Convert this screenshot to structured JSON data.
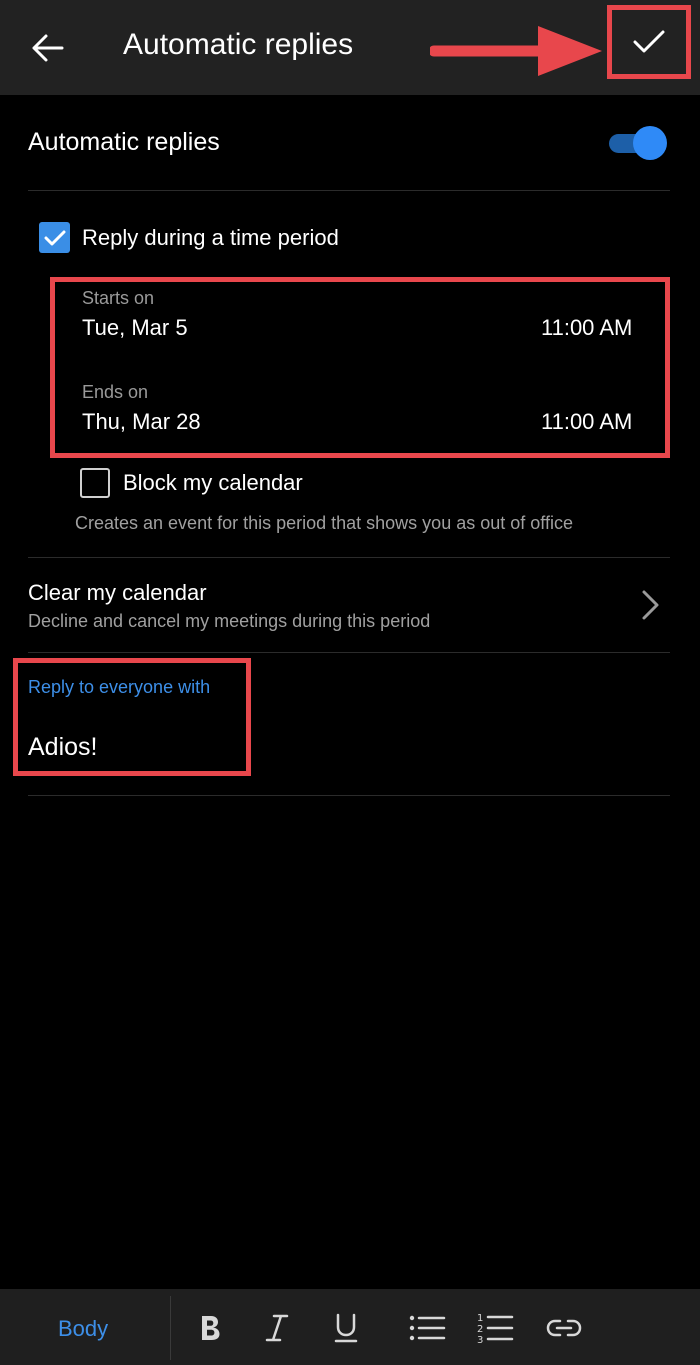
{
  "header": {
    "title": "Automatic replies",
    "back_icon": "arrow-left-icon",
    "confirm_icon": "checkmark-icon"
  },
  "auto_replies": {
    "label": "Automatic replies",
    "enabled": true
  },
  "time_period": {
    "label": "Reply during a time period",
    "checked": true,
    "starts_label": "Starts on",
    "start_date": "Tue, Mar 5",
    "start_time": "11:00 AM",
    "ends_label": "Ends on",
    "end_date": "Thu, Mar 28",
    "end_time": "11:00 AM"
  },
  "block_calendar": {
    "label": "Block my calendar",
    "checked": false,
    "description": "Creates an event for this period that shows you as out of office"
  },
  "clear_calendar": {
    "title": "Clear my calendar",
    "description": "Decline and cancel my meetings during this period"
  },
  "reply": {
    "label": "Reply to everyone with",
    "message": "Adios!"
  },
  "toolbar": {
    "style_label": "Body",
    "icons": [
      "bold-icon",
      "italic-icon",
      "underline-icon",
      "bullet-list-icon",
      "numbered-list-icon",
      "link-icon"
    ]
  },
  "colors": {
    "accent_blue": "#3d8fe8",
    "annotation_red": "#e8474c",
    "header_bg": "#222222",
    "background": "#000000"
  }
}
